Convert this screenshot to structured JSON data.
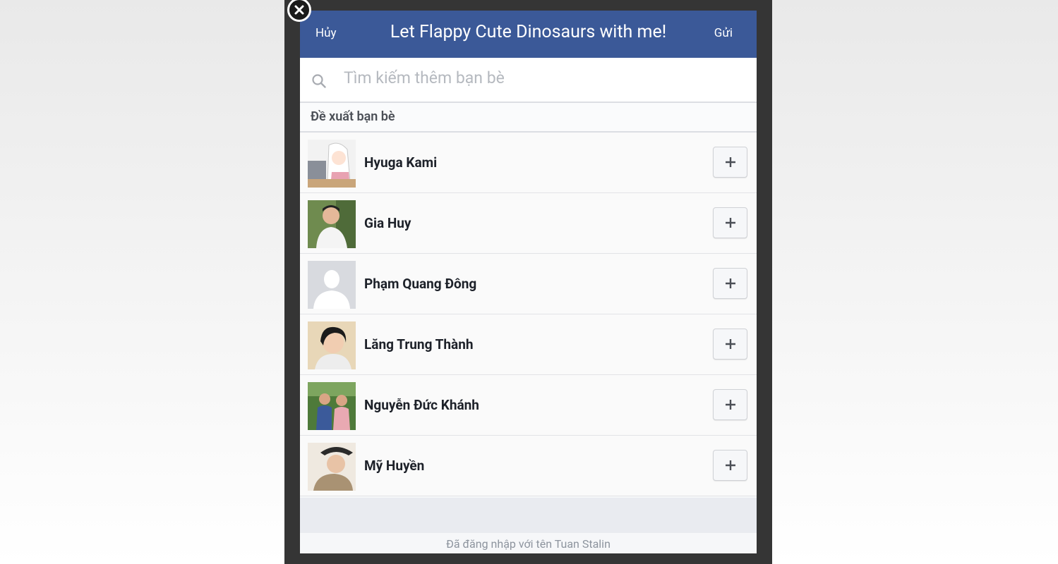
{
  "header": {
    "cancel_label": "Hủy",
    "title": "Let Flappy Cute Dinosaurs with me!",
    "send_label": "Gửi"
  },
  "search": {
    "icon": "search-icon",
    "placeholder": "Tìm kiếm thêm bạn bè"
  },
  "suggestions": {
    "section_label": "Đề xuất bạn bè",
    "items": [
      {
        "name": "Hyuga Kami",
        "add_icon": "plus-icon"
      },
      {
        "name": "Gia Huy",
        "add_icon": "plus-icon"
      },
      {
        "name": "Phạm Quang Đông",
        "add_icon": "plus-icon"
      },
      {
        "name": "Lăng Trung Thành",
        "add_icon": "plus-icon"
      },
      {
        "name": "Nguyễn Đức Khánh",
        "add_icon": "plus-icon"
      },
      {
        "name": "Mỹ Huyền",
        "add_icon": "plus-icon"
      }
    ]
  },
  "footer": {
    "logged_in_text": "Đã đăng nhập với tên Tuan Stalin"
  },
  "colors": {
    "header_bg": "#3b5998",
    "frame_bg": "#353535"
  }
}
